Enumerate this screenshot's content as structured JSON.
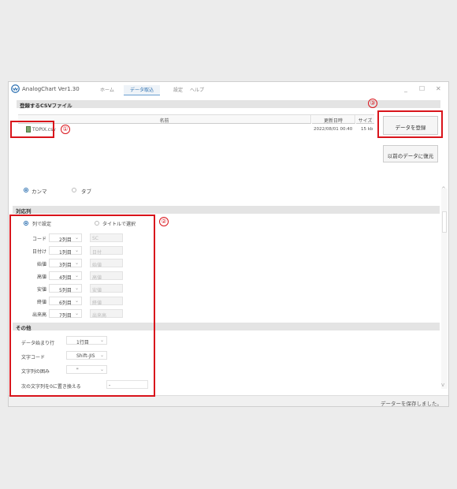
{
  "app": {
    "title": "AnalogChart Ver1.30"
  },
  "tabs": [
    "ホーム",
    "データ取込",
    "設定",
    "ヘルプ"
  ],
  "window_controls": [
    "_",
    "☐",
    "✕"
  ],
  "csv_section": {
    "title": "登録するCSVファイル"
  },
  "file_table": {
    "headers": [
      "名前",
      "更新日時",
      "サイズ"
    ],
    "rows": [
      {
        "name": "TOPIX.csv",
        "updated": "2022/08/01 00:40",
        "size": "15 kb"
      }
    ]
  },
  "buttons": {
    "register": "データを登録",
    "restore": "以前のデータに復元"
  },
  "delimiter": {
    "comma": "カンマ",
    "tab": "タブ"
  },
  "mapping_section": {
    "title": "対応列"
  },
  "mapping_mode": {
    "by_column": "列で設定",
    "by_title": "タイトルで選択"
  },
  "mapping_rows": [
    {
      "label": "コード",
      "value": "2列目",
      "placeholder": "SC"
    },
    {
      "label": "日付け",
      "value": "1列目",
      "placeholder": "日付"
    },
    {
      "label": "始値",
      "value": "3列目",
      "placeholder": "始値"
    },
    {
      "label": "高値",
      "value": "4列目",
      "placeholder": "高値"
    },
    {
      "label": "安値",
      "value": "5列目",
      "placeholder": "安値"
    },
    {
      "label": "終値",
      "value": "6列目",
      "placeholder": "終値"
    },
    {
      "label": "出来高",
      "value": "7列目",
      "placeholder": "出来高"
    }
  ],
  "other_section": {
    "title": "その他"
  },
  "other": {
    "start_row_label": "データ始まり行",
    "start_row_value": "1行目",
    "encoding_label": "文字コード",
    "encoding_value": "Shift-JIS",
    "quote_label": "文字列の囲み",
    "quote_value": "\"",
    "replace_label": "次の文字列を0に置き換える",
    "replace_value": "-"
  },
  "callouts": [
    "①",
    "②",
    "③"
  ],
  "status": {
    "text": "データーを保存しました。"
  },
  "colors": {
    "accent": "#2b6fb0",
    "highlight": "#d9141b"
  }
}
